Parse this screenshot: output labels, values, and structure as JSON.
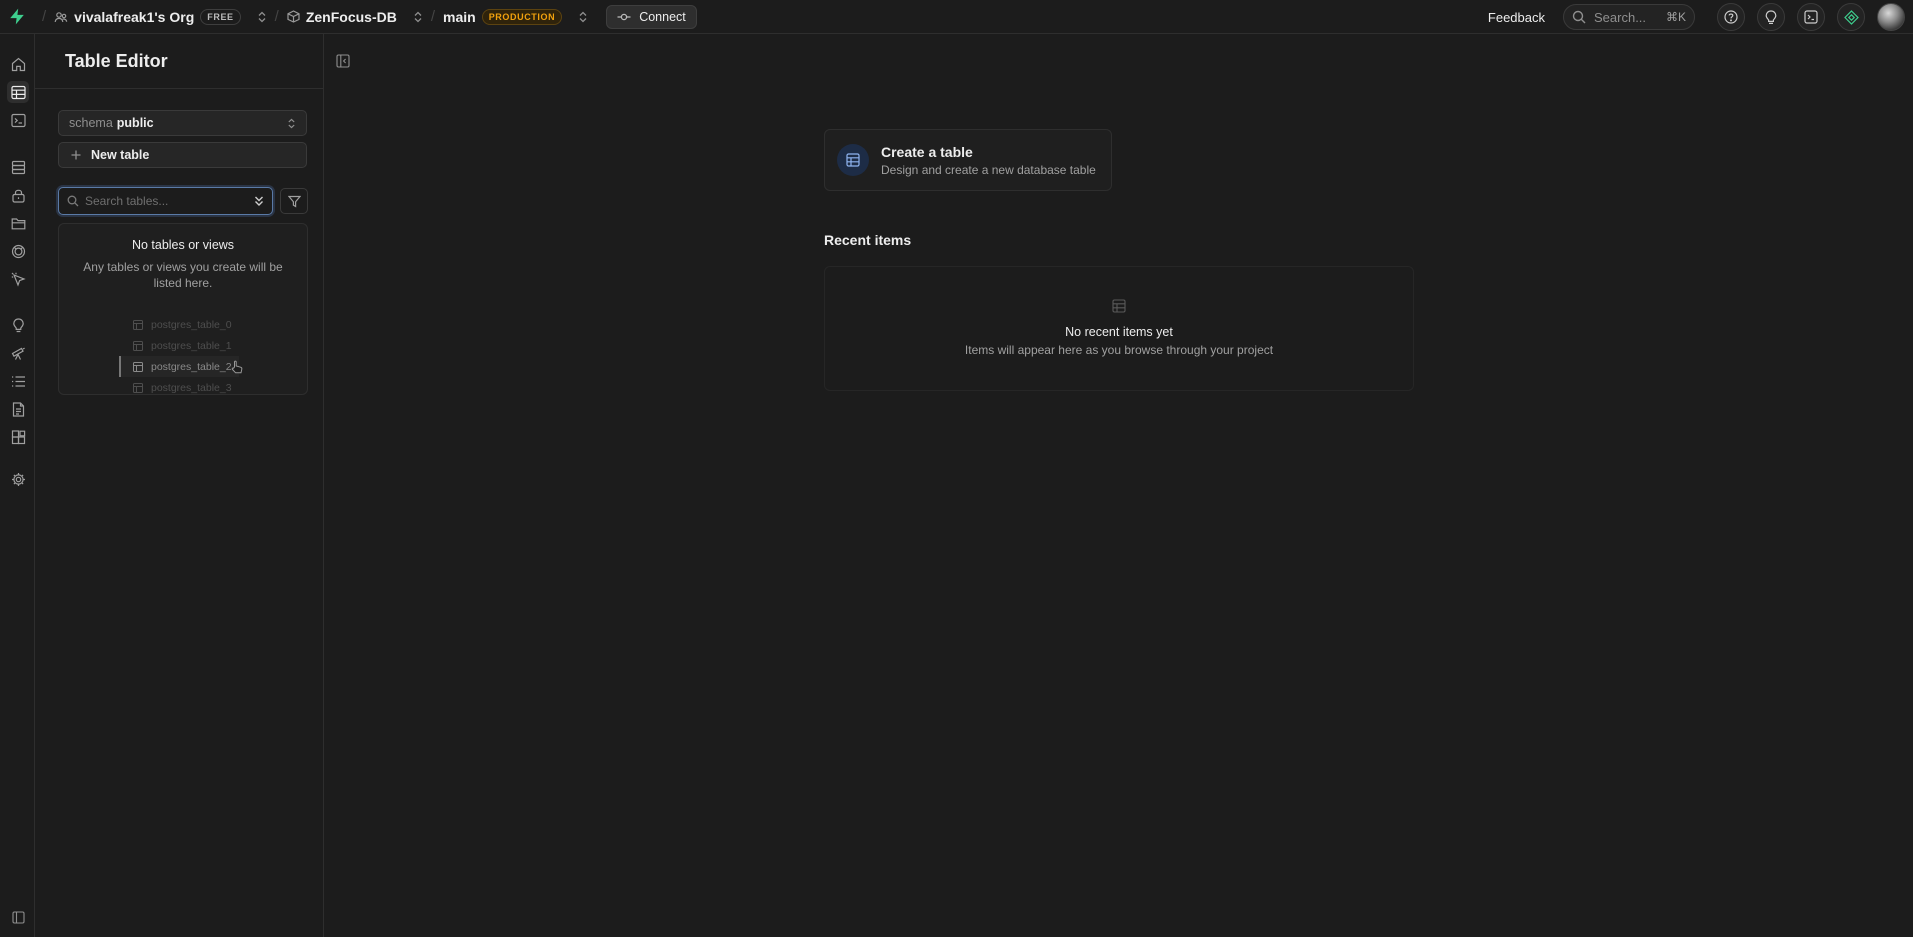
{
  "topbar": {
    "org_name": "vivalafreak1's Org",
    "org_badge": "FREE",
    "project_name": "ZenFocus-DB",
    "branch_name": "main",
    "branch_badge": "PRODUCTION",
    "connect_label": "Connect",
    "feedback_label": "Feedback",
    "search_placeholder": "Search...",
    "search_shortcut": "⌘K"
  },
  "sidebar": {
    "title": "Table Editor",
    "schema_label": "schema",
    "schema_value": "public",
    "new_table_label": "New table",
    "search_placeholder": "Search tables...",
    "empty_title": "No tables or views",
    "empty_description": "Any tables or views you create will be listed here.",
    "placeholder_tables": [
      "postgres_table_0",
      "postgres_table_1",
      "postgres_table_2",
      "postgres_table_3"
    ]
  },
  "main": {
    "create_title": "Create a table",
    "create_description": "Design and create a new database table",
    "recent_title": "Recent items",
    "recent_empty_title": "No recent items yet",
    "recent_empty_description": "Items will appear here as you browse through your project"
  },
  "colors": {
    "background": "#1c1c1c",
    "brand_green": "#3ecf8e",
    "production_badge": "#f1a10d",
    "focus_ring": "#5a7aa6"
  }
}
